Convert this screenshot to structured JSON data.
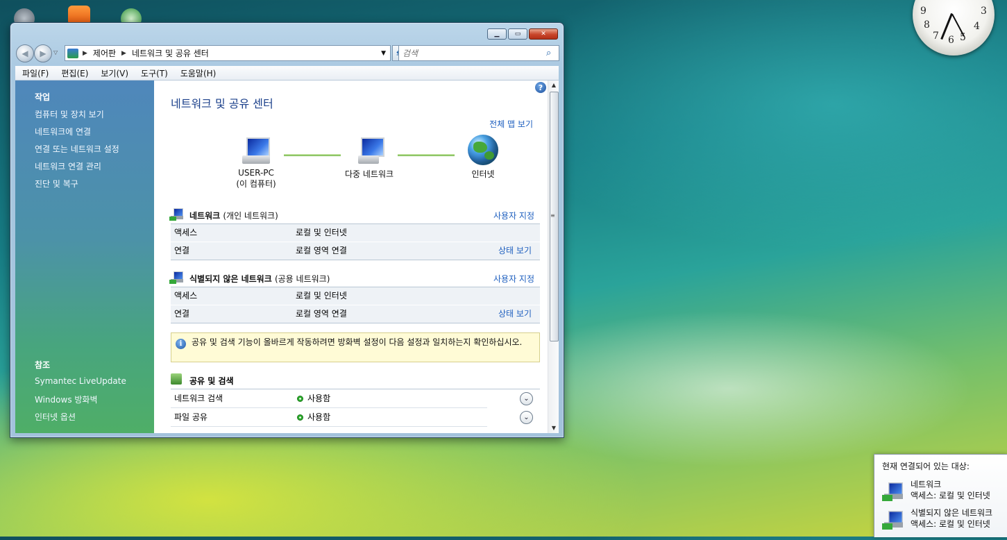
{
  "window": {
    "address": {
      "crumbs": [
        "제어판",
        "네트워크 및 공유 센터"
      ]
    },
    "search_placeholder": "검색",
    "menu": [
      "파일(F)",
      "편집(E)",
      "보기(V)",
      "도구(T)",
      "도움말(H)"
    ]
  },
  "sidebar": {
    "tasks_title": "작업",
    "tasks": [
      "컴퓨터 및 장치 보기",
      "네트워크에 연결",
      "연결 또는 네트워크 설정",
      "네트워크 연결 관리",
      "진단 및 복구"
    ],
    "see_also_title": "참조",
    "see_also": [
      "Symantec LiveUpdate",
      "Windows 방화벽",
      "인터넷 옵션"
    ]
  },
  "main": {
    "title": "네트워크 및 공유 센터",
    "full_map_link": "전체 맵 보기",
    "map": {
      "computer": {
        "name": "USER-PC",
        "sub": "(이 컴퓨터)"
      },
      "multi": "다중 네트워크",
      "internet": "인터넷"
    },
    "networks": [
      {
        "name": "네트워크",
        "type": "(개인 네트워크)",
        "customize": "사용자 지정",
        "rows": [
          {
            "label": "액세스",
            "value": "로컬 및 인터넷",
            "link": ""
          },
          {
            "label": "연결",
            "value": "로컬 영역 연결",
            "link": "상태 보기"
          }
        ]
      },
      {
        "name": "식별되지 않은 네트워크",
        "type": "(공용 네트워크)",
        "customize": "사용자 지정",
        "rows": [
          {
            "label": "액세스",
            "value": "로컬 및 인터넷",
            "link": ""
          },
          {
            "label": "연결",
            "value": "로컬 영역 연결",
            "link": "상태 보기"
          }
        ]
      }
    ],
    "info_message": "공유 및 검색 기능이 올바르게 작동하려면 방화벽 설정이 다음 설정과 일치하는지 확인하십시오.",
    "sharing_title": "공유 및 검색",
    "sharing": [
      {
        "label": "네트워크 검색",
        "value": "사용함"
      },
      {
        "label": "파일 공유",
        "value": "사용함"
      }
    ]
  },
  "tray": {
    "header": "현재 연결되어 있는 대상:",
    "items": [
      {
        "name": "네트워크",
        "access": "액세스:  로컬 및 인터넷"
      },
      {
        "name": "식별되지 않은 네트워크",
        "access": "액세스:  로컬 및 인터넷"
      }
    ]
  },
  "colors": {
    "sidebar_top": "#4f87bb",
    "sidebar_bottom": "#4fae67",
    "link": "#1e5fbf",
    "title": "#1a3f8a",
    "info_bg": "#fffbd6",
    "status_green": "#2eae2e"
  }
}
